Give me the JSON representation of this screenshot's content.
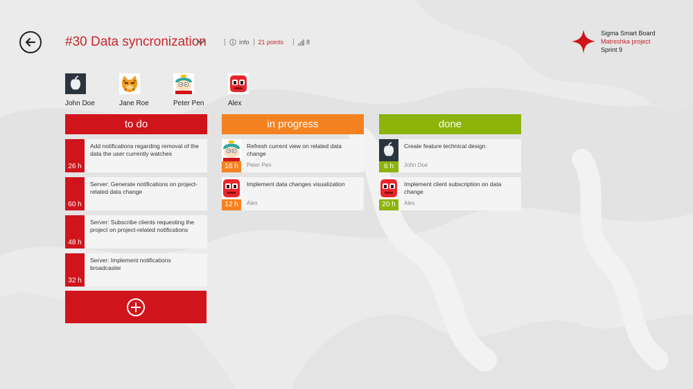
{
  "header": {
    "title": "#30 Data syncronization",
    "info_label": "info",
    "points_label": "21 points",
    "count_label": "8"
  },
  "brand": {
    "name": "Sigma Smart Board",
    "project": "Matreshka project",
    "sprint": "Sprint 9"
  },
  "team": [
    {
      "name": "John Doe",
      "avatar": "apple-avatar-icon"
    },
    {
      "name": "Jane Roe",
      "avatar": "cat-avatar-icon"
    },
    {
      "name": "Peter Pen",
      "avatar": "cartoon-avatar-icon"
    },
    {
      "name": "Alex",
      "avatar": "robot-avatar-icon"
    }
  ],
  "columns": {
    "todo": {
      "label": "to do",
      "color": "#d0141c",
      "cards": [
        {
          "text": "Add notifications regarding removal of the data the user currently watches",
          "hours": "26 h"
        },
        {
          "text": "Server: Generate notifications on project-related data change",
          "hours": "60 h"
        },
        {
          "text": "Server: Subscribe clients requesting the project on project-related notifications",
          "hours": "48 h"
        },
        {
          "text": "Server: Implement notifications broadcaster",
          "hours": "32 h"
        }
      ]
    },
    "inprogress": {
      "label": "in progress",
      "color": "#f58220",
      "cards": [
        {
          "text": "Refresh current view on related data change",
          "hours": "16 h",
          "assignee": "Peter Pen"
        },
        {
          "text": "Implement data changes visualization",
          "hours": "12 h",
          "assignee": "Alex"
        }
      ]
    },
    "done": {
      "label": "done",
      "color": "#8cb40a",
      "cards": [
        {
          "text": "Create feature technical design",
          "hours": "6 h",
          "assignee": "John Doe"
        },
        {
          "text": "Implement client subscription on data change",
          "hours": "20 h",
          "assignee": "Alex"
        }
      ]
    }
  },
  "add_button": {
    "icon": "plus-circle-icon"
  }
}
